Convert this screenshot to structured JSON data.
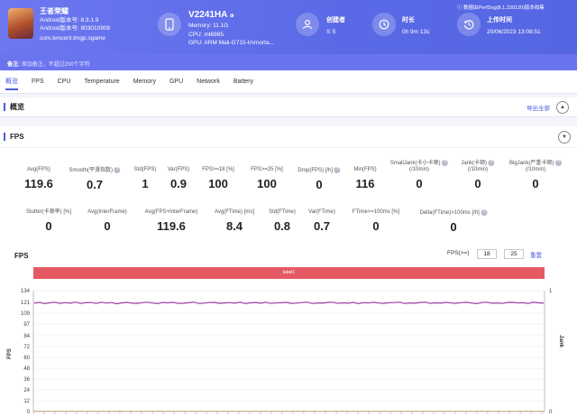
{
  "app": {
    "name": "王者荣耀",
    "android_version": "Android版本号: 8.3.1.9",
    "android_build": "Android版本号: 803010908",
    "package": "com.tencent.tmgp.sgame"
  },
  "device": {
    "model": "V2241HA",
    "memory": "Memory: 11.1G",
    "cpu": "CPU: mt6985",
    "gpu": "GPU: ARM Mali-G715-Immorta..."
  },
  "creator": {
    "label": "创建者",
    "value": "S S"
  },
  "duration": {
    "label": "时长",
    "value": "0h 9m 13s"
  },
  "upload": {
    "label": "上传时间",
    "value": "20/06/2023 13:08:51"
  },
  "data_source": "数据由PerfDog(8.1.230120)版本收集",
  "remark": {
    "label": "备注:",
    "text": "添加备注，不超过200个字符"
  },
  "tabs": [
    "概览",
    "FPS",
    "CPU",
    "Temperature",
    "Memory",
    "GPU",
    "Network",
    "Battery"
  ],
  "overview": {
    "title": "概览",
    "export_label": "导出全部"
  },
  "fps_section": {
    "title": "FPS"
  },
  "stats_row1": [
    {
      "label": "Avg(FPS)",
      "value": "119.6"
    },
    {
      "label": "Smooth(平滑指数)",
      "value": "0.7",
      "help": "?"
    },
    {
      "label": "Std(FPS)",
      "value": "1"
    },
    {
      "label": "Var(FPS)",
      "value": "0.9"
    },
    {
      "label": "FPS>=18 [%]",
      "value": "100"
    },
    {
      "label": "FPS>=25 [%]",
      "value": "100"
    },
    {
      "label": "Drop(FPS) [/h]",
      "value": "0",
      "help": "?"
    },
    {
      "label": "Min(FPS)",
      "value": "116"
    },
    {
      "label": "SmallJank(卡小卡顿)",
      "label2": "(/10min)",
      "value": "0",
      "help": "?"
    },
    {
      "label": "Jank(卡顿)",
      "label2": "(/10min)",
      "value": "0",
      "help": "?"
    },
    {
      "label": "BigJank(严重卡顿)",
      "label2": "(/10min)",
      "value": "0",
      "help": "?"
    }
  ],
  "stats_row2": [
    {
      "label": "Stutter(卡顿率) [%]",
      "value": "0"
    },
    {
      "label": "Avg(InterFrame)",
      "value": "0"
    },
    {
      "label": "Avg(FPS+InterFrame)",
      "value": "119.6"
    },
    {
      "label": "Avg(FTime) [ms]",
      "value": "8.4"
    },
    {
      "label": "Std(FTime)",
      "value": "0.8"
    },
    {
      "label": "Var(FTime)",
      "value": "0.7"
    },
    {
      "label": "FTime>=100ms [%]",
      "value": "0"
    },
    {
      "label": "Delta(FTime)>100ms [/h]",
      "value": "0",
      "help": "?"
    }
  ],
  "chart_controls": {
    "title": "FPS",
    "threshold_label": "FPS(>=)",
    "threshold_1": "18",
    "threshold_2": "25",
    "reset_label": "重置",
    "label_bar": "label1"
  },
  "chart_data": {
    "type": "line",
    "ylabel": "FPS",
    "y2label": "Jank",
    "ylim": [
      0,
      134
    ],
    "yticks": [
      0,
      12,
      24,
      36,
      48,
      60,
      72,
      84,
      97,
      109,
      121,
      134
    ],
    "y2ticks": [
      0,
      1
    ],
    "series": [
      {
        "name": "FPS",
        "color": "#a03fa8",
        "mean": 120.4,
        "values": [
          120.1,
          121.0,
          119.6,
          120.5,
          121.2,
          119.9,
          120.7,
          120.0,
          121.3,
          119.8,
          120.6,
          120.9,
          119.7,
          121.1,
          120.2,
          120.8,
          119.5,
          120.4,
          121.0,
          120.1,
          119.9,
          120.7,
          121.2,
          120.3,
          119.6,
          120.9,
          120.5,
          121.1,
          119.8,
          120.0,
          120.6,
          121.3,
          119.7,
          120.2,
          120.8,
          121.0,
          119.9,
          120.4,
          120.7,
          120.1,
          121.2,
          119.6,
          120.5,
          120.9,
          120.0,
          121.1,
          119.8,
          120.3,
          120.6,
          121.0,
          119.9,
          120.2,
          120.8,
          121.3,
          119.7,
          120.4,
          120.1,
          120.9,
          121.2,
          119.8,
          120.5,
          120.0,
          121.0,
          119.6,
          120.7,
          120.3,
          121.1,
          120.2,
          119.9,
          120.6,
          120.8,
          121.2,
          119.7,
          120.4,
          120.0,
          120.9,
          121.3,
          119.8,
          120.5,
          120.1,
          121.0,
          120.3,
          119.9,
          120.7,
          121.1,
          120.2,
          119.6,
          120.8,
          121.2,
          120.0,
          120.4,
          119.8,
          120.9,
          121.0,
          120.3,
          120.6,
          119.7,
          121.1,
          120.5,
          120.1
        ]
      },
      {
        "name": "Jank",
        "color": "#c8a070",
        "values": [
          0
        ]
      }
    ]
  }
}
